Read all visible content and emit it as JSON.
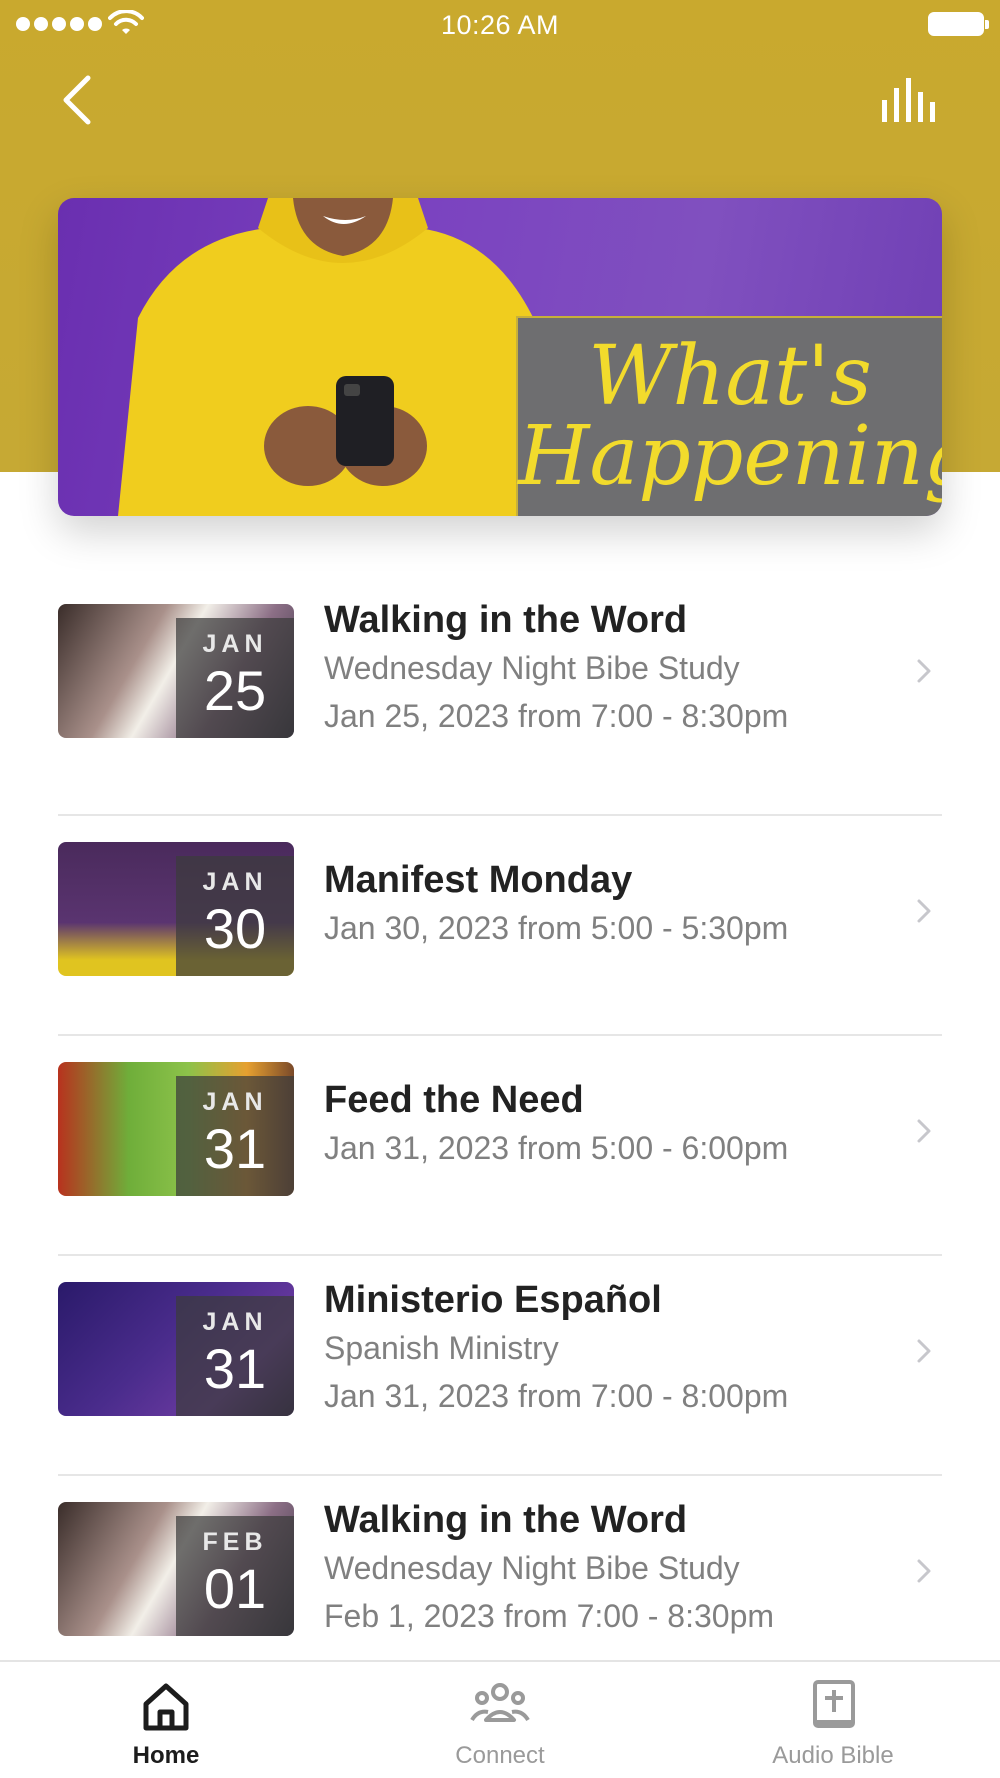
{
  "status_bar": {
    "time": "10:26 AM"
  },
  "header": {
    "back_icon": "chevron-left-icon",
    "menu_icon": "equalizer-bars-icon",
    "accent_color": "#c6a934"
  },
  "banner": {
    "line1": "What's",
    "line2": "Happening?",
    "text_color": "#f2db2c"
  },
  "events": [
    {
      "title": "Walking in the Word",
      "subtitle": "Wednesday Night Bibe Study",
      "when": "Jan 25, 2023 from 7:00 - 8:30pm",
      "month": "JAN",
      "day": "25"
    },
    {
      "title": "Manifest Monday",
      "subtitle": "",
      "when": "Jan 30, 2023 from 5:00 - 5:30pm",
      "month": "JAN",
      "day": "30"
    },
    {
      "title": "Feed the Need",
      "subtitle": "",
      "when": "Jan 31, 2023 from 5:00 - 6:00pm",
      "month": "JAN",
      "day": "31"
    },
    {
      "title": "Ministerio Español",
      "subtitle": "Spanish Ministry",
      "when": "Jan 31, 2023 from 7:00 - 8:00pm",
      "month": "JAN",
      "day": "31"
    },
    {
      "title": "Walking in the Word",
      "subtitle": "Wednesday Night Bibe Study",
      "when": "Feb 1, 2023 from 7:00 - 8:30pm",
      "month": "FEB",
      "day": "01"
    }
  ],
  "tabs": [
    {
      "label": "Home",
      "icon": "home-icon",
      "active": true
    },
    {
      "label": "Connect",
      "icon": "people-group-icon",
      "active": false
    },
    {
      "label": "Audio Bible",
      "icon": "bible-book-icon",
      "active": false
    }
  ]
}
